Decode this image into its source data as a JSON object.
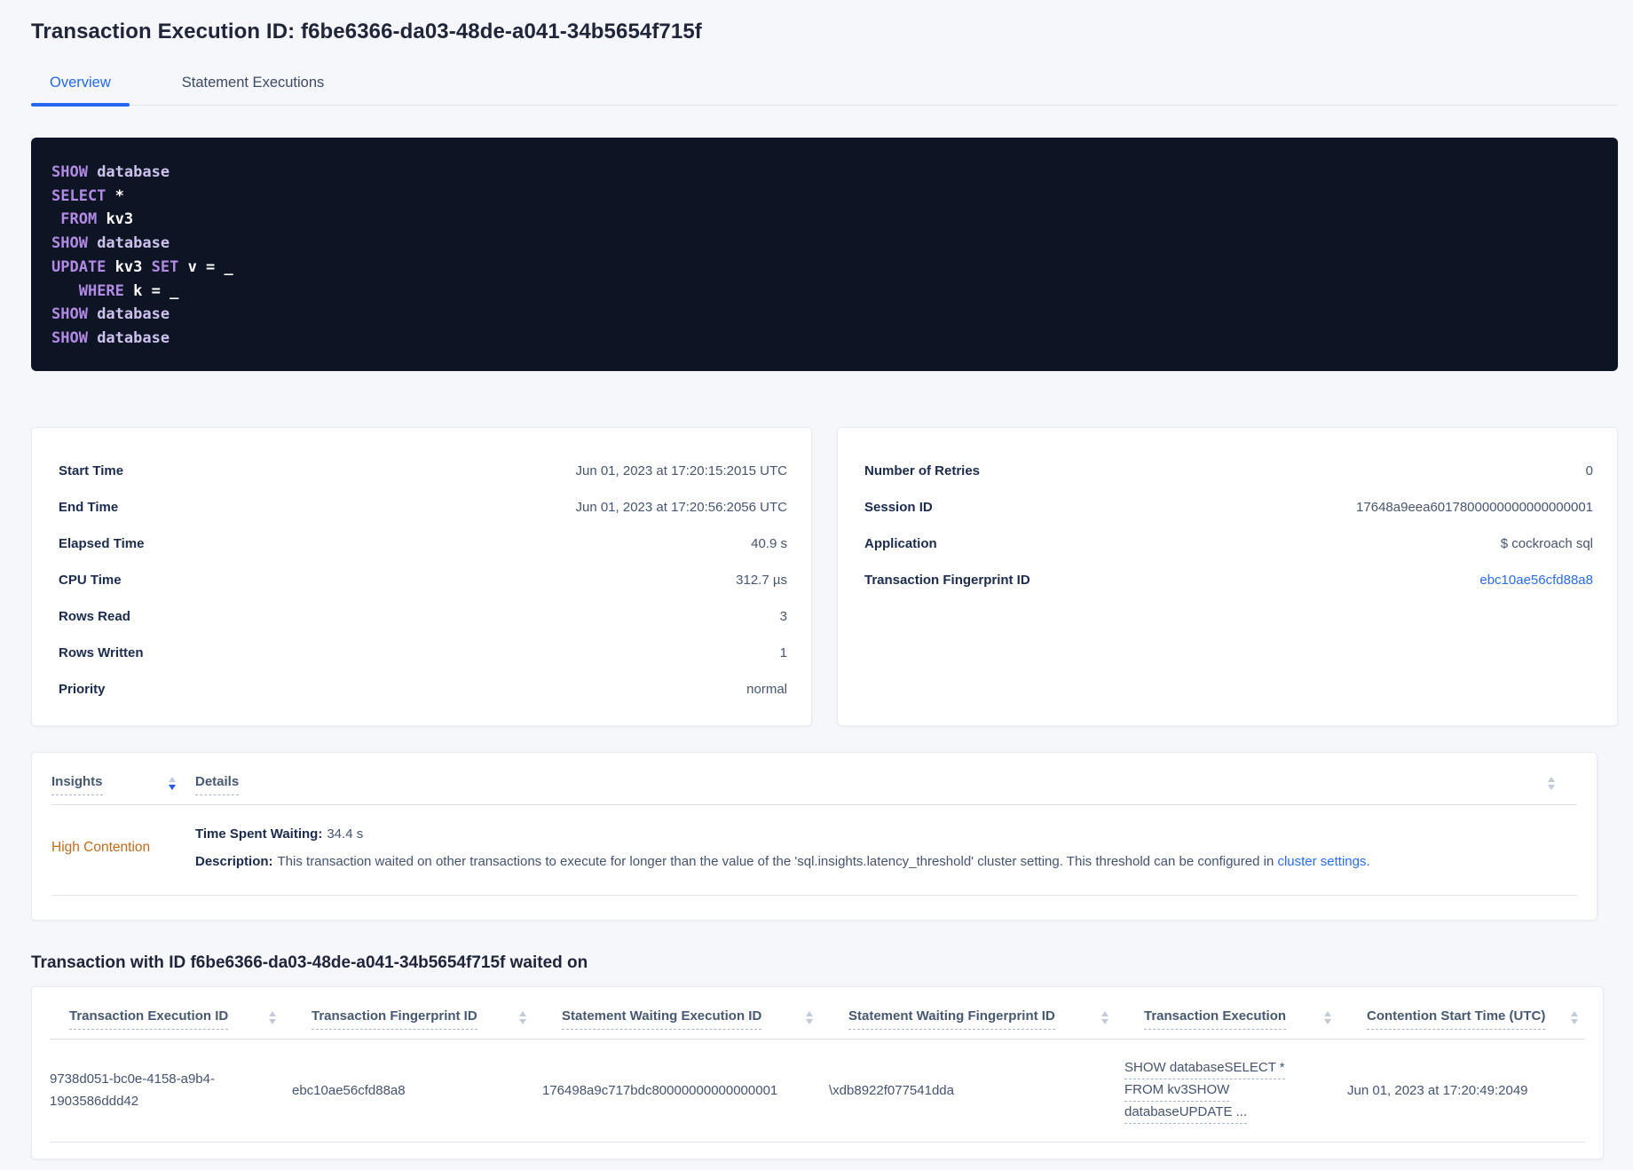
{
  "page": {
    "title": "Transaction Execution ID: f6be6366-da03-48de-a041-34b5654f715f",
    "waited_on_heading": "Transaction with ID f6be6366-da03-48de-a041-34b5654f715f waited on"
  },
  "tabs": [
    {
      "label": "Overview",
      "active": true
    },
    {
      "label": "Statement Executions",
      "active": false
    }
  ],
  "sql_box": {
    "lines": [
      [
        {
          "t": "SHOW ",
          "c": "kw"
        },
        {
          "t": "database",
          "c": "id"
        }
      ],
      [
        {
          "t": "SELECT ",
          "c": "kw"
        },
        {
          "t": "*",
          "c": "pl"
        }
      ],
      [
        {
          "t": " ",
          "c": "pl"
        },
        {
          "t": "FROM ",
          "c": "kw"
        },
        {
          "t": "kv3",
          "c": "pl"
        }
      ],
      [
        {
          "t": "SHOW ",
          "c": "kw"
        },
        {
          "t": "database",
          "c": "id"
        }
      ],
      [
        {
          "t": "UPDATE ",
          "c": "kw"
        },
        {
          "t": "kv3 ",
          "c": "pl"
        },
        {
          "t": "SET ",
          "c": "kw"
        },
        {
          "t": "v = _",
          "c": "pl"
        }
      ],
      [
        {
          "t": "   ",
          "c": "pl"
        },
        {
          "t": "WHERE ",
          "c": "kw"
        },
        {
          "t": "k = _",
          "c": "pl"
        }
      ],
      [
        {
          "t": "SHOW ",
          "c": "kw"
        },
        {
          "t": "database",
          "c": "id"
        }
      ],
      [
        {
          "t": "SHOW ",
          "c": "kw"
        },
        {
          "t": "database",
          "c": "id"
        }
      ]
    ]
  },
  "summary_left": {
    "rows": [
      {
        "label": "Start Time",
        "value": "Jun 01, 2023 at 17:20:15:2015 UTC"
      },
      {
        "label": "End Time",
        "value": "Jun 01, 2023 at 17:20:56:2056 UTC"
      },
      {
        "label": "Elapsed Time",
        "value": "40.9 s"
      },
      {
        "label": "CPU Time",
        "value": "312.7 µs"
      },
      {
        "label": "Rows Read",
        "value": "3"
      },
      {
        "label": "Rows Written",
        "value": "1"
      },
      {
        "label": "Priority",
        "value": "normal"
      }
    ]
  },
  "summary_right": {
    "rows": [
      {
        "label": "Number of Retries",
        "value": "0"
      },
      {
        "label": "Session ID",
        "value": "17648a9eea6017800000000000000001"
      },
      {
        "label": "Application",
        "value": "$ cockroach sql"
      },
      {
        "label": "Transaction Fingerprint ID",
        "value": "ebc10ae56cfd88a8",
        "link": true
      }
    ]
  },
  "insights_table": {
    "columns": [
      {
        "label": "Insights",
        "sort": "desc"
      },
      {
        "label": "Details",
        "sort": null
      }
    ],
    "row": {
      "insight_label": "High Contention",
      "time_spent_waiting_label": "Time Spent Waiting:",
      "time_spent_waiting_value": "34.4 s",
      "description_label": "Description:",
      "description_text": "This transaction waited on other transactions to execute for longer than the value of the 'sql.insights.latency_threshold' cluster setting. This threshold can be configured in ",
      "description_link": "cluster settings",
      "description_suffix": "."
    }
  },
  "waited_on_table": {
    "columns": [
      "Transaction Execution ID",
      "Transaction Fingerprint ID",
      "Statement Waiting Execution ID",
      "Statement Waiting Fingerprint ID",
      "Transaction Execution",
      "Contention Start Time (UTC)"
    ],
    "rows": [
      {
        "transaction_execution_id": "9738d051-bc0e-4158-a9b4-1903586ddd42",
        "transaction_fingerprint_id": "ebc10ae56cfd88a8",
        "statement_waiting_execution_id": "176498a9c717bdc80000000000000001",
        "statement_waiting_fingerprint_id": "\\xdb8922f077541dda",
        "transaction_execution_lines": [
          "SHOW databaseSELECT *",
          "FROM kv3SHOW",
          "databaseUPDATE ..."
        ],
        "contention_start_time": "Jun 01, 2023 at 17:20:49:2049"
      }
    ]
  },
  "colors": {
    "accent_blue": "#2368ee",
    "sort_active_blue": "#2458e5",
    "insight_orange": "#bf6a1d",
    "code_background": "#0d1424",
    "code_keyword": "#b38ae5",
    "code_identifier": "#cdc2ee",
    "code_plain": "#ffffff",
    "page_background": "#f5f7fa"
  }
}
